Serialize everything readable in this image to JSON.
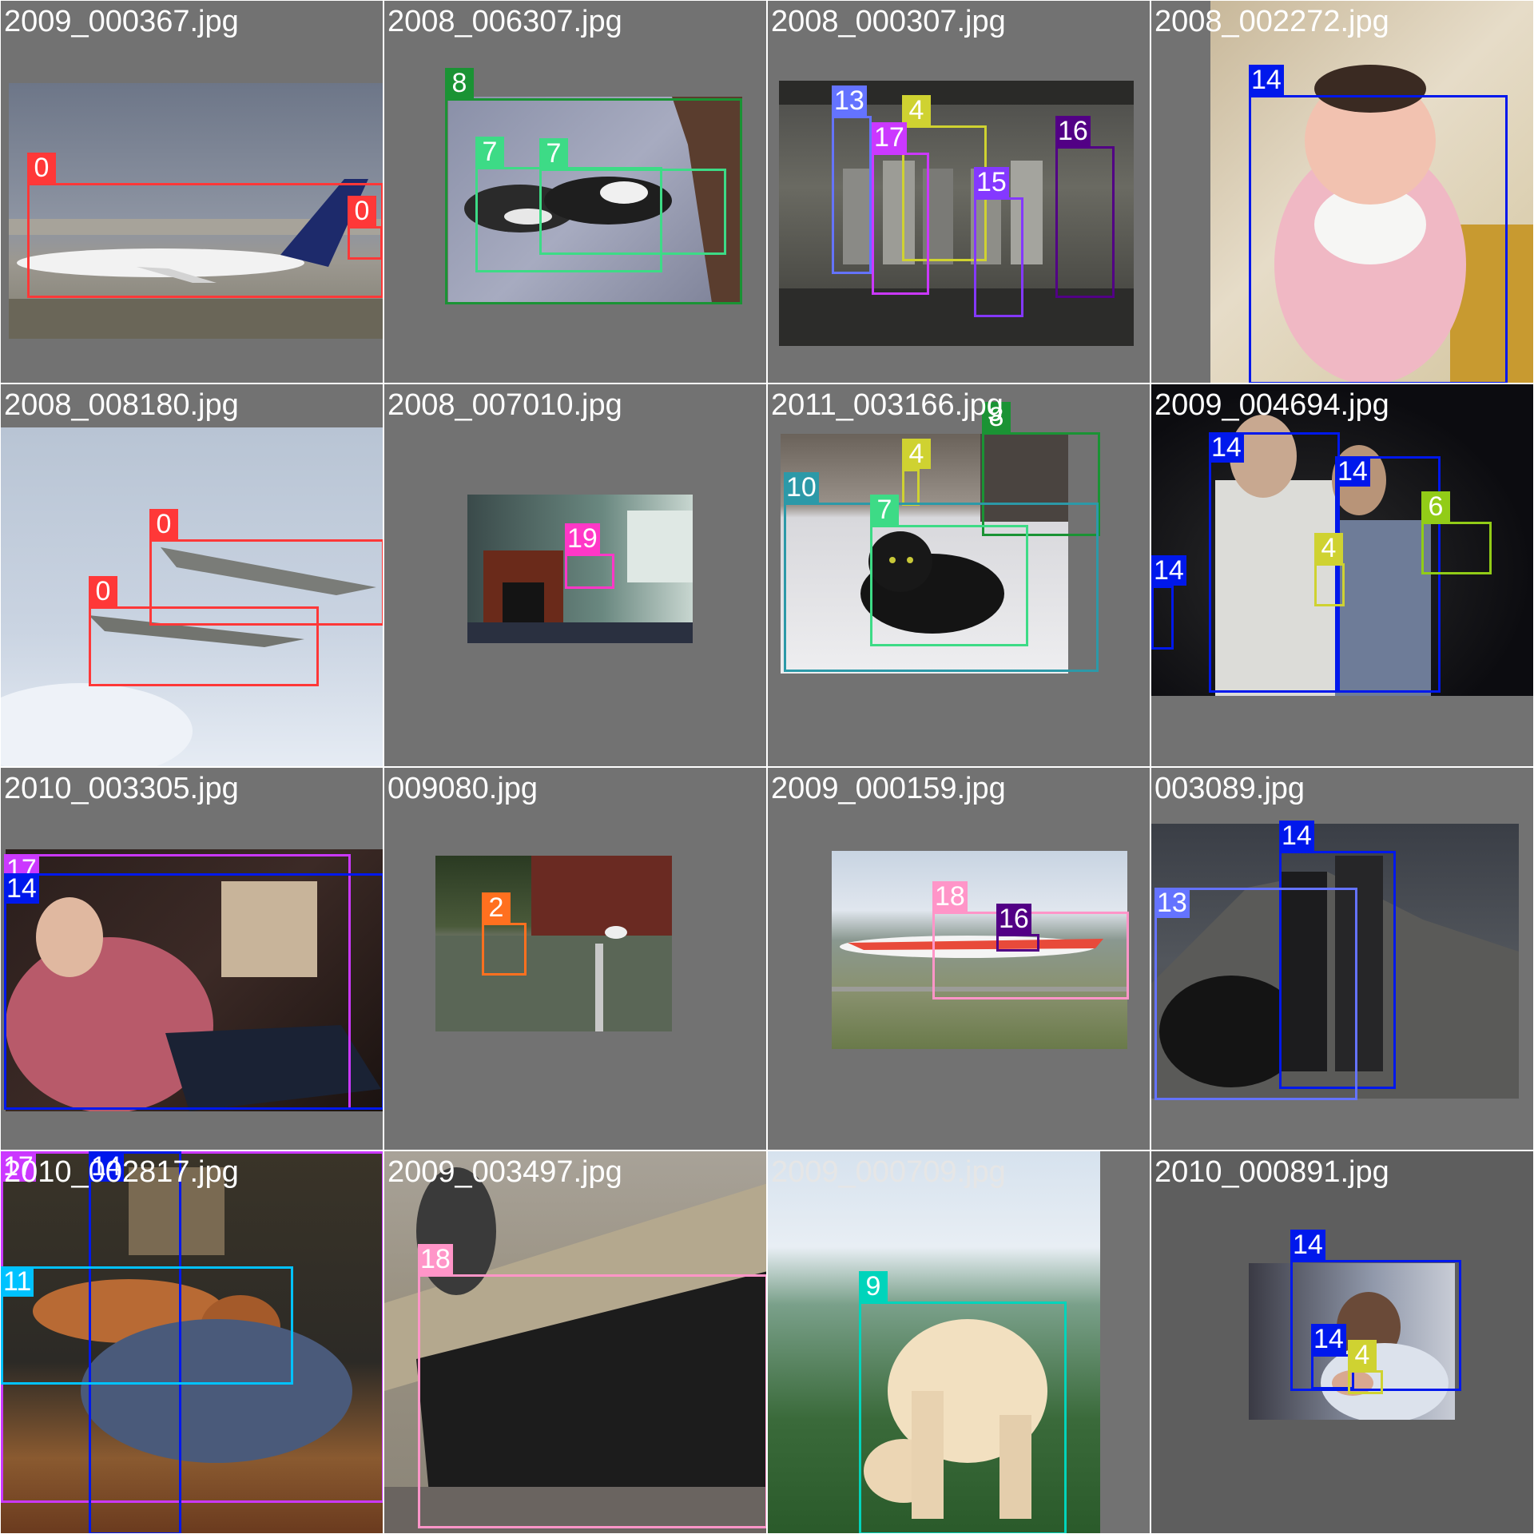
{
  "tiles": [
    {
      "filename": "2009_000367.jpg",
      "labels": [
        "0",
        "0"
      ]
    },
    {
      "filename": "2008_006307.jpg",
      "labels": [
        "8",
        "7",
        "7"
      ]
    },
    {
      "filename": "2008_000307.jpg",
      "labels": [
        "13",
        "4",
        "17",
        "16",
        "15"
      ]
    },
    {
      "filename": "2008_002272.jpg",
      "labels": [
        "14"
      ]
    },
    {
      "filename": "2008_008180.jpg",
      "labels": [
        "0",
        "0"
      ]
    },
    {
      "filename": "2008_007010.jpg",
      "labels": [
        "19"
      ]
    },
    {
      "filename": "2011_003166.jpg",
      "labels": [
        "8",
        "4",
        "10",
        "7"
      ]
    },
    {
      "filename": "2009_004694.jpg",
      "labels": [
        "14",
        "14",
        "6",
        "14",
        "4"
      ]
    },
    {
      "filename": "2010_003305.jpg",
      "labels": [
        "17",
        "14"
      ]
    },
    {
      "filename": "009080.jpg",
      "labels": [
        "2"
      ]
    },
    {
      "filename": "2009_000159.jpg",
      "labels": [
        "18",
        "16"
      ]
    },
    {
      "filename": "003089.jpg",
      "labels": [
        "14",
        "13"
      ]
    },
    {
      "filename": "2010_002817.jpg",
      "labels": [
        "17",
        "14",
        "11"
      ]
    },
    {
      "filename": "2009_003497.jpg",
      "labels": [
        "18"
      ]
    },
    {
      "filename": "2009_000709.jpg",
      "labels": [
        "9"
      ]
    },
    {
      "filename": "2010_000891.jpg",
      "labels": [
        "14",
        "14",
        "4"
      ]
    }
  ],
  "class_colors": {
    "0": "#ff3838",
    "2": "#ff701f",
    "4": "#cfd231",
    "6": "#92cc17",
    "7": "#3ddb86",
    "8": "#1a9334",
    "9": "#00d4bb",
    "10": "#2c99a8",
    "11": "#00c2ff",
    "13": "#6473ff",
    "14": "#0018ec",
    "15": "#8438ff",
    "16": "#520085",
    "17": "#cb38ff",
    "18": "#ff95c8",
    "19": "#ff37c7"
  }
}
